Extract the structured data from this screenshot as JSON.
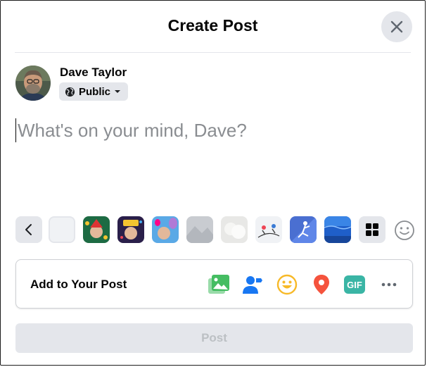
{
  "dialog": {
    "title": "Create Post"
  },
  "user": {
    "name": "Dave Taylor",
    "privacy_label": "Public"
  },
  "composer": {
    "placeholder": "What's on your mind, Dave?"
  },
  "backgrounds": {
    "swatches": [
      "plain",
      "holiday-gnome",
      "2020-celebration",
      "balloon-face",
      "gray-photo",
      "white-fluffy",
      "skaters",
      "purple-dancer",
      "blue-water"
    ]
  },
  "add_to_post": {
    "label": "Add to Your Post",
    "tools": [
      "photo-video",
      "tag-people",
      "feeling-activity",
      "check-in",
      "gif",
      "more"
    ],
    "gif_text": "GIF"
  },
  "post_button": {
    "label": "Post"
  },
  "colors": {
    "photo": "#45bd62",
    "tag": "#1877f2",
    "feeling": "#f7b928",
    "checkin": "#f5533d",
    "gif": "#3ab5a5",
    "disabled_button": "#e4e6eb"
  }
}
